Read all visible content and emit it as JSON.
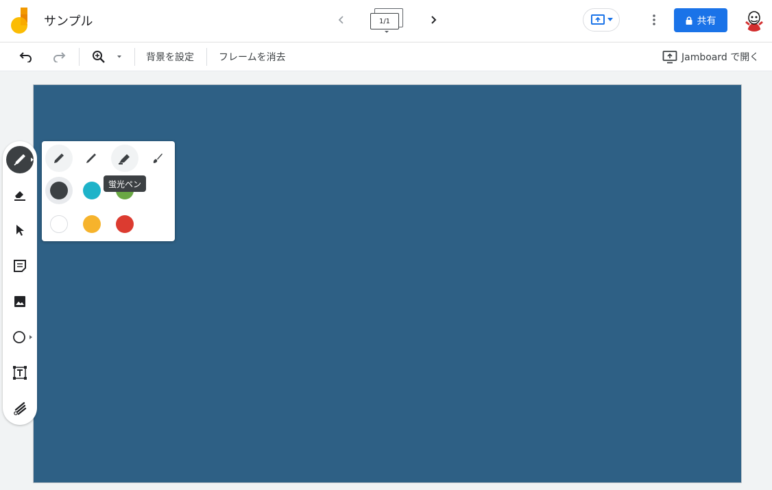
{
  "app": {
    "title": "サンプル"
  },
  "frames": {
    "counter": "1/1"
  },
  "header": {
    "share_label": "共有"
  },
  "toolbar": {
    "set_background": "背景を設定",
    "clear_frame": "フレームを消去",
    "open_in_jamboard": "Jamboard で開く"
  },
  "side_tools": [
    "pen-icon",
    "eraser-icon",
    "select-icon",
    "sticky-note-icon",
    "image-icon",
    "circle-icon",
    "text-box-icon",
    "laser-icon"
  ],
  "pen_panel": {
    "pen_types": [
      "marker-icon",
      "pen-icon",
      "highlighter-icon",
      "brush-icon"
    ],
    "colors": [
      "#3c4043",
      "#1eb3c9",
      "#6aa844",
      "#ffffff",
      "#f6b32c",
      "#dc3b30"
    ],
    "tooltip": "蛍光ペン"
  },
  "canvas": {
    "background": "#2e6085"
  },
  "colors": {
    "accent": "#1a73e8"
  }
}
